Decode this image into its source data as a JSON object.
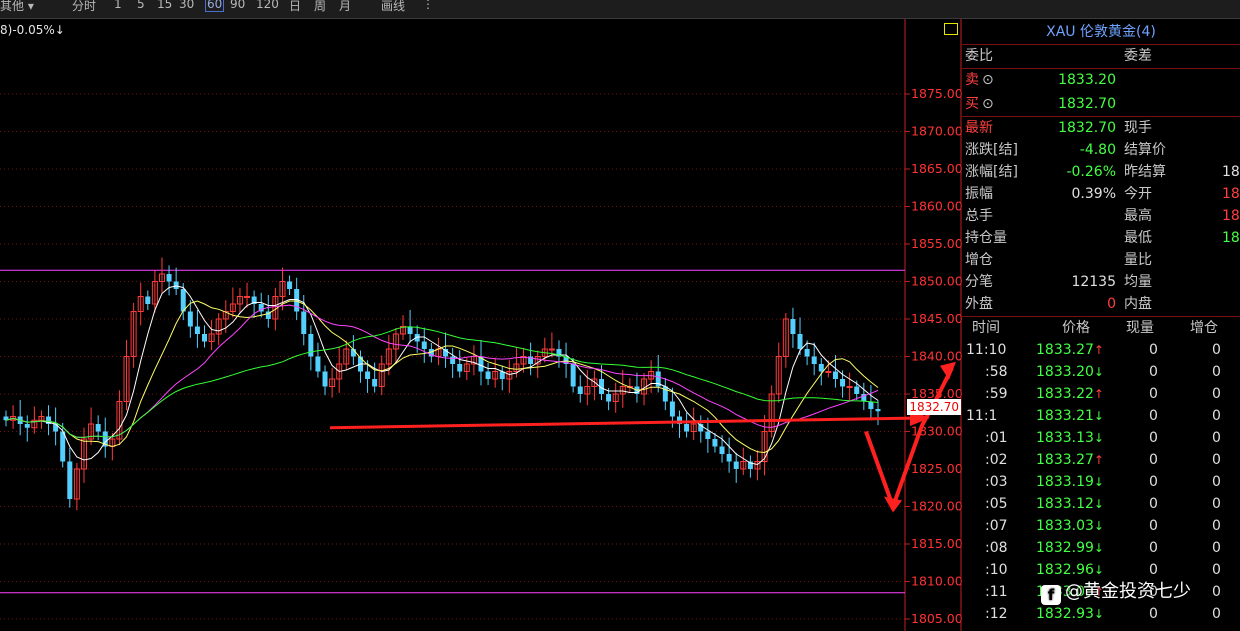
{
  "toolbar": {
    "items": [
      "其他 ▾",
      "分时",
      "1",
      "5",
      "15",
      "30",
      "60",
      "90",
      "120",
      "日",
      "周",
      "月",
      "画线",
      "⋮"
    ],
    "selected": "60"
  },
  "indicator_text": "8)-0.05%↓",
  "instrument": {
    "title": "XAU 伦敦黄金(4)"
  },
  "quote": {
    "weibi_label": "委比",
    "weicha_label": "委差",
    "sell_label": "卖",
    "sell_price": "1833.20",
    "buy_label": "买",
    "buy_price": "1832.70",
    "rows": [
      {
        "label": "最新",
        "value": "1832.70",
        "label2": "现手",
        "value2": ""
      },
      {
        "label": "涨跌[结]",
        "value": "-4.80",
        "label2": "结算价",
        "value2": ""
      },
      {
        "label": "涨幅[结]",
        "value": "-0.26%",
        "label2": "昨结算",
        "value2": "18"
      },
      {
        "label": "振幅",
        "value": "0.39%",
        "label2": "今开",
        "value2": "18"
      },
      {
        "label": "总手",
        "value": "",
        "label2": "最高",
        "value2": "18"
      },
      {
        "label": "持仓量",
        "value": "",
        "label2": "最低",
        "value2": "18"
      },
      {
        "label": "增仓",
        "value": "",
        "label2": "量比",
        "value2": ""
      },
      {
        "label": "分笔",
        "value": "12135",
        "label2": "均量",
        "value2": ""
      },
      {
        "label": "外盘",
        "value": "0",
        "label2": "内盘",
        "value2": ""
      }
    ]
  },
  "ticks": {
    "headers": [
      "时间",
      "价格",
      "现量",
      "增仓"
    ],
    "rows": [
      {
        "time": "11:10",
        "price": "1833.27",
        "dir": "↑",
        "vol": "0",
        "oi": "0"
      },
      {
        "time": ":58",
        "price": "1833.20",
        "dir": "↓",
        "vol": "0",
        "oi": "0"
      },
      {
        "time": ":59",
        "price": "1833.22",
        "dir": "↑",
        "vol": "0",
        "oi": "0"
      },
      {
        "time": "11:1",
        "price": "1833.21",
        "dir": "↓",
        "vol": "0",
        "oi": "0"
      },
      {
        "time": ":01",
        "price": "1833.13",
        "dir": "↓",
        "vol": "0",
        "oi": "0"
      },
      {
        "time": ":02",
        "price": "1833.27",
        "dir": "↑",
        "vol": "0",
        "oi": "0"
      },
      {
        "time": ":03",
        "price": "1833.19",
        "dir": "↓",
        "vol": "0",
        "oi": "0"
      },
      {
        "time": ":05",
        "price": "1833.12",
        "dir": "↓",
        "vol": "0",
        "oi": "0"
      },
      {
        "time": ":07",
        "price": "1833.03",
        "dir": "↓",
        "vol": "0",
        "oi": "0"
      },
      {
        "time": ":08",
        "price": "1832.99",
        "dir": "↓",
        "vol": "0",
        "oi": "0"
      },
      {
        "time": ":10",
        "price": "1832.96",
        "dir": "↓",
        "vol": "0",
        "oi": "0"
      },
      {
        "time": ":11",
        "price": "1833.03",
        "dir": "↑",
        "vol": "0",
        "oi": "0"
      },
      {
        "time": ":12",
        "price": "1832.93",
        "dir": "↓",
        "vol": "0",
        "oi": "0"
      }
    ]
  },
  "price_badge": "1832.70",
  "watermark": "@黄金投资七少",
  "chart_data": {
    "type": "candlestick",
    "ylim": [
      1803,
      1882
    ],
    "y_ticks": [
      "1875.00",
      "1870.00",
      "1865.00",
      "1860.00",
      "1855.00",
      "1850.00",
      "1845.00",
      "1840.00",
      "1835.00",
      "1830.00",
      "1825.00",
      "1820.00",
      "1815.00",
      "1810.00",
      "1805.00"
    ],
    "y_tick_values": [
      1875,
      1870,
      1865,
      1860,
      1855,
      1850,
      1845,
      1840,
      1835,
      1830,
      1825,
      1820,
      1815,
      1810,
      1805
    ],
    "horizontal_levels": [
      1851.5,
      1808.5
    ],
    "close_series": [
      1831.5,
      1832,
      1831,
      1830.5,
      1831.5,
      1832,
      1831,
      1830,
      1826,
      1821,
      1825,
      1829,
      1831,
      1830,
      1828,
      1829,
      1834,
      1840,
      1846,
      1848,
      1847,
      1850,
      1851,
      1850,
      1849,
      1846,
      1844,
      1843,
      1842,
      1843,
      1845,
      1846,
      1847,
      1848,
      1848,
      1847,
      1846,
      1845,
      1848,
      1850,
      1849,
      1846,
      1843,
      1840,
      1838,
      1836,
      1837,
      1839,
      1841,
      1840,
      1838,
      1837,
      1836,
      1839,
      1841,
      1843,
      1844,
      1843,
      1842,
      1841,
      1840,
      1841,
      1840,
      1839,
      1838,
      1839,
      1840,
      1838,
      1837,
      1838,
      1837,
      1838,
      1839,
      1840,
      1839,
      1840,
      1841,
      1841,
      1840,
      1839,
      1836,
      1835,
      1836,
      1837,
      1835,
      1834,
      1835,
      1836,
      1836,
      1835,
      1837,
      1838,
      1836,
      1834,
      1832,
      1831,
      1830,
      1831,
      1830,
      1829,
      1828,
      1827,
      1826,
      1825,
      1826,
      1825,
      1826,
      1830,
      1835,
      1840,
      1845,
      1843,
      1841,
      1840,
      1839,
      1838,
      1838,
      1837,
      1836,
      1836,
      1835,
      1834,
      1833,
      1832.7
    ],
    "annotations": [
      {
        "type": "line",
        "from": [
          330,
          1830.5
        ],
        "to": [
          922,
          1831.8
        ]
      },
      {
        "type": "polyline",
        "points": [
          [
            866,
            1830
          ],
          [
            893,
            1820
          ],
          [
            922,
            1830.8
          ],
          [
            935,
            1834
          ],
          [
            952,
            1838.5
          ]
        ]
      }
    ]
  },
  "colors": {
    "up": "#ff3a3a",
    "down": "#54d0ff",
    "ma5": "#ffffff",
    "ma10": "#ffff66",
    "ma20": "#ff44ff",
    "ma60": "#33ff33",
    "grid": "#7a1010",
    "axis": "#c02020",
    "annotation": "#ff2020"
  }
}
